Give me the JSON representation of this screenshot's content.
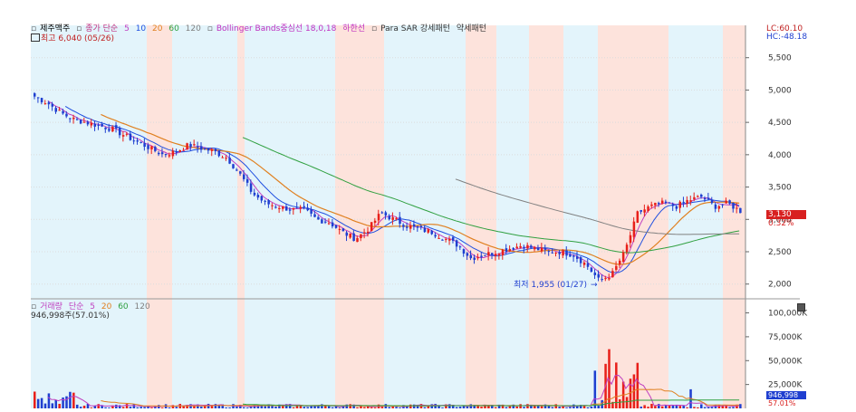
{
  "price_panel": {
    "legend": {
      "stock_name": "제주맥주",
      "ma_label": "종가 단순",
      "ma_periods": [
        "5",
        "10",
        "20",
        "60",
        "120"
      ],
      "bollinger": "Bollinger Bands중심선 18,0,18",
      "bollinger_lower": "하한선",
      "sar": "Para SAR 강세패턴",
      "sar_weak": "약세패턴"
    },
    "high_marker": "최고 6,040 (05/26)",
    "low_marker": "최저 1,955 (01/27)",
    "lc_label": "LC:60.10",
    "hc_label": "HC:-48.18",
    "current_price": "3,130",
    "current_change": "0.32%",
    "y_ticks": [
      "5,500",
      "5,000",
      "4,500",
      "4,000",
      "3,500",
      "3,000",
      "2,500",
      "2,000"
    ]
  },
  "volume_panel": {
    "legend": {
      "title": "거래량",
      "ma_label": "단순",
      "ma_periods": [
        "5",
        "20",
        "60",
        "120"
      ]
    },
    "current_label": "946,998주(57.01%)",
    "current_volume": "946,998",
    "current_pct": "57.01%",
    "y_ticks": [
      "100,000K",
      "75,000K",
      "50,000K",
      "25,000K"
    ]
  },
  "colors": {
    "up": "#e8201a",
    "down": "#1f3fd0",
    "bg_blue": "#e3f4fb",
    "bg_red": "#fde3dc",
    "ma5": "#c040c0",
    "ma10": "#2050e0",
    "ma20": "#e08020",
    "ma60": "#30a040",
    "ma120": "#808080"
  },
  "chart_data": {
    "type": "candlestick",
    "price_axis": {
      "ylim": [
        1800,
        6000
      ]
    },
    "volume_axis": {
      "ylim": [
        0,
        110000
      ]
    },
    "approx_close_series": [
      4900,
      4800,
      4650,
      4550,
      4500,
      4450,
      4400,
      4300,
      4200,
      4100,
      4000,
      4050,
      4150,
      4100,
      4050,
      3950,
      3700,
      3400,
      3250,
      3200,
      3150,
      3150,
      3000,
      2950,
      2800,
      2700,
      2850,
      3100,
      3000,
      2900,
      2850,
      2800,
      2700,
      2600,
      2400,
      2450,
      2500,
      2550,
      2600,
      2550,
      2500,
      2500,
      2450,
      2300,
      2050,
      2150,
      2500,
      3100,
      3200,
      3250,
      3200,
      3300,
      3350,
      3200,
      3250,
      3130
    ]
  }
}
